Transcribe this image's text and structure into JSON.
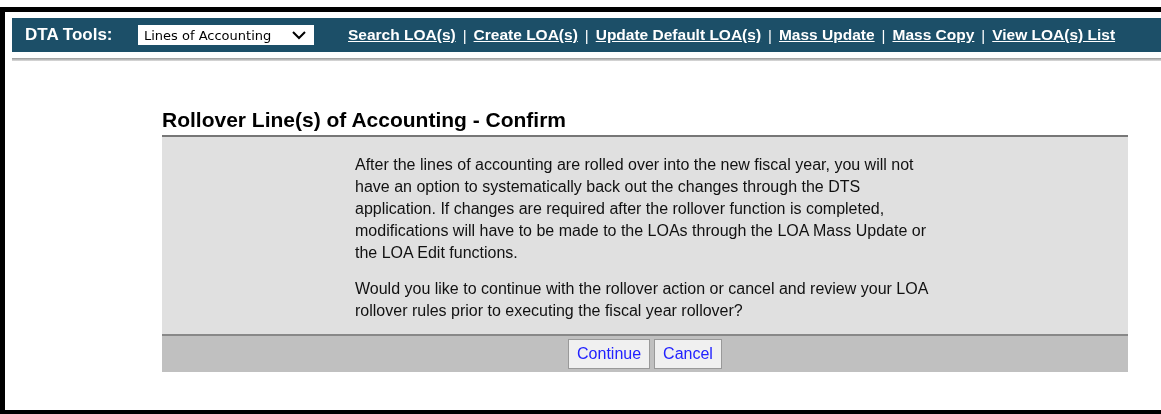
{
  "toolbar": {
    "label": "DTA Tools:",
    "select": {
      "value": "Lines of Accounting"
    },
    "links": [
      "Search LOA(s)",
      "Create LOA(s)",
      "Update Default LOA(s)",
      "Mass Update",
      "Mass Copy",
      "View LOA(s) List"
    ],
    "separator": "|"
  },
  "page": {
    "title": "Rollover Line(s) of Accounting - Confirm",
    "paragraphs": [
      "After the lines of accounting are rolled over into the new fiscal year, you will not have an option to systematically back out the changes through the DTS application. If changes are required after the rollover function is completed, modifications will have to be made to the LOAs through the LOA Mass Update or the LOA Edit functions.",
      "Would you like to continue with the rollover action or cancel and review your LOA rollover rules prior to executing the fiscal year rollover?"
    ],
    "buttons": [
      "Continue",
      "Cancel"
    ]
  }
}
